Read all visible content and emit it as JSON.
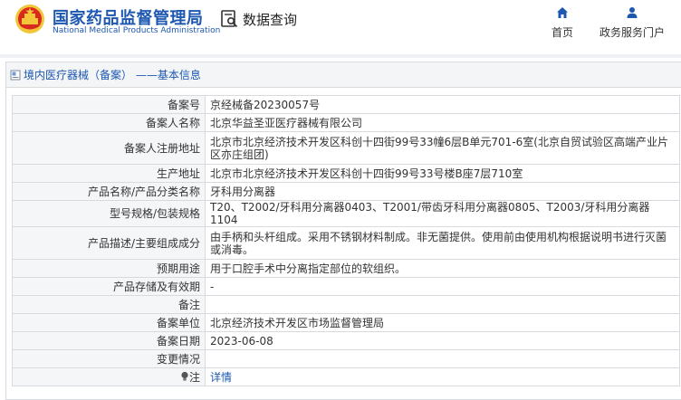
{
  "header": {
    "brand_cn": "国家药品监督管理局",
    "brand_en": "National Medical Products Administration",
    "search_label": "数据查询",
    "nav": [
      {
        "label": "首页",
        "icon": "home-icon"
      },
      {
        "label": "政务服务门户",
        "icon": "user-icon"
      }
    ]
  },
  "colors": {
    "brand_blue": "#1d57b0",
    "logo_red": "#d9281e",
    "logo_gold": "#f3c63a"
  },
  "panel": {
    "title": "境内医疗器械（备案） ——基本信息"
  },
  "rows": [
    {
      "label": "备案号",
      "value": "京经械备20230057号"
    },
    {
      "label": "备案人名称",
      "value": "北京华益圣亚医疗器械有限公司"
    },
    {
      "label": "备案人注册地址",
      "value": "北京市北京经济技术开发区科创十四街99号33幢6层B单元701-6室(北京自贸试验区高端产业片区亦庄组团)"
    },
    {
      "label": "生产地址",
      "value": "北京市北京经济技术开发区科创十四街99号33号楼B座7层710室"
    },
    {
      "label": "产品名称/产品分类名称",
      "value": "牙科用分离器"
    },
    {
      "label": "型号规格/包装规格",
      "value": "T20、T2002/牙科用分离器0403、T2001/带齿牙科用分离器0805、T2003/牙科用分离器1104"
    },
    {
      "label": "产品描述/主要组成成分",
      "value": "由手柄和头杆组成。采用不锈钢材料制成。非无菌提供。使用前由使用机构根据说明书进行灭菌或消毒。"
    },
    {
      "label": "预期用途",
      "value": "用于口腔手术中分离指定部位的软组织。"
    },
    {
      "label": "产品存储及有效期",
      "value": "-"
    },
    {
      "label": "备注",
      "value": ""
    },
    {
      "label": "备案单位",
      "value": "北京经济技术开发区市场监督管理局"
    },
    {
      "label": "备案日期",
      "value": "2023-06-08"
    },
    {
      "label": "变更情况",
      "value": ""
    }
  ],
  "note_row": {
    "label": "注",
    "icon": "lightbulb-icon",
    "link": "详情"
  }
}
